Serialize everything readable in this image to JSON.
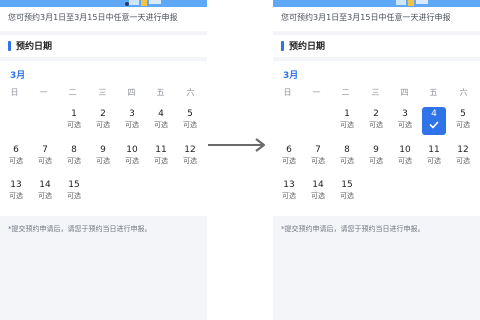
{
  "left": {
    "notice": "您可预约3月1日至3月15日中任意一天进行申报",
    "section_title": "预约日期",
    "month": "3月",
    "weekdays": [
      "日",
      "一",
      "二",
      "三",
      "四",
      "五",
      "六"
    ],
    "days": [
      {
        "num": "1",
        "status": "可选"
      },
      {
        "num": "2",
        "status": "可选"
      },
      {
        "num": "3",
        "status": "可选"
      },
      {
        "num": "4",
        "status": "可选"
      },
      {
        "num": "5",
        "status": "可选"
      },
      {
        "num": "6",
        "status": "可选"
      },
      {
        "num": "7",
        "status": "可选"
      },
      {
        "num": "8",
        "status": "可选"
      },
      {
        "num": "9",
        "status": "可选"
      },
      {
        "num": "10",
        "status": "可选"
      },
      {
        "num": "11",
        "status": "可选"
      },
      {
        "num": "12",
        "status": "可选"
      },
      {
        "num": "13",
        "status": "可选"
      },
      {
        "num": "14",
        "status": "可选"
      },
      {
        "num": "15",
        "status": "可选"
      }
    ],
    "footnote": "*提交预约申请后，请您于预约当日进行申报。"
  },
  "right": {
    "notice": "您可预约3月1日至3月15日中任意一天进行申报",
    "section_title": "预约日期",
    "month": "3月",
    "weekdays": [
      "日",
      "一",
      "二",
      "三",
      "四",
      "五",
      "六"
    ],
    "days": [
      {
        "num": "1",
        "status": "可选"
      },
      {
        "num": "2",
        "status": "可选"
      },
      {
        "num": "3",
        "status": "可选"
      },
      {
        "num": "4",
        "status": "",
        "selected": true
      },
      {
        "num": "5",
        "status": "可选"
      },
      {
        "num": "6",
        "status": "可选"
      },
      {
        "num": "7",
        "status": "可选"
      },
      {
        "num": "8",
        "status": "可选"
      },
      {
        "num": "9",
        "status": "可选"
      },
      {
        "num": "10",
        "status": "可选"
      },
      {
        "num": "11",
        "status": "可选"
      },
      {
        "num": "12",
        "status": "可选"
      },
      {
        "num": "13",
        "status": "可选"
      },
      {
        "num": "14",
        "status": "可选"
      },
      {
        "num": "15",
        "status": "可选"
      }
    ],
    "footnote": "*提交预约申请后，请您于预约当日进行申报。"
  },
  "colors": {
    "accent": "#2f73e8",
    "banner": "#5fa8f5",
    "background": "#f3f5f9",
    "arrow": "#6b6b6b"
  },
  "icons": {
    "arrow": "arrow-right-icon",
    "check": "check-icon"
  }
}
